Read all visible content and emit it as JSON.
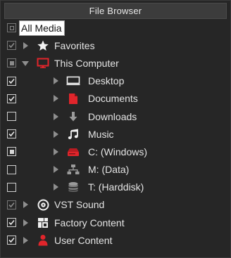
{
  "panel": {
    "title": "File Browser"
  },
  "tree": {
    "root": {
      "label": "All Media",
      "check": "mixed-dim"
    },
    "favorites": {
      "label": "Favorites",
      "check": "checked-dim",
      "expander": "collapsed",
      "icon": "star-icon"
    },
    "this_computer": {
      "label": "This Computer",
      "check": "mixed-dim",
      "expander": "expanded",
      "icon": "monitor-icon",
      "icon_color": "#e0252b"
    },
    "desktop": {
      "label": "Desktop",
      "check": "checked",
      "expander": "collapsed",
      "icon": "desktop-icon"
    },
    "documents": {
      "label": "Documents",
      "check": "checked",
      "expander": "collapsed",
      "icon": "document-icon",
      "icon_color": "#e0252b"
    },
    "downloads": {
      "label": "Downloads",
      "check": "unchecked",
      "expander": "collapsed",
      "icon": "download-icon"
    },
    "music": {
      "label": "Music",
      "check": "checked",
      "expander": "collapsed",
      "icon": "music-note-icon"
    },
    "c_drive": {
      "label": "C: (Windows)",
      "check": "mixed",
      "expander": "collapsed",
      "icon": "drive-icon",
      "icon_color": "#e0252b"
    },
    "m_drive": {
      "label": "M: (Data)",
      "check": "unchecked",
      "expander": "collapsed",
      "icon": "network-drive-icon"
    },
    "t_drive": {
      "label": "T: (Harddisk)",
      "check": "unchecked",
      "expander": "collapsed",
      "icon": "disk-stack-icon"
    },
    "vst_sound": {
      "label": "VST Sound",
      "check": "checked-dim",
      "expander": "collapsed",
      "icon": "vst-sound-icon"
    },
    "factory_content": {
      "label": "Factory Content",
      "check": "checked",
      "expander": "collapsed",
      "icon": "factory-content-icon"
    },
    "user_content": {
      "label": "User Content",
      "check": "checked",
      "expander": "collapsed",
      "icon": "user-icon",
      "icon_color": "#e0252b"
    }
  }
}
